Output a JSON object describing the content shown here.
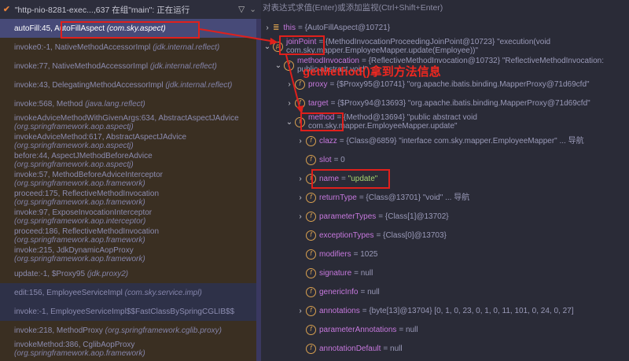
{
  "frames_header": {
    "thread": "\"http-nio-8281-exec...,637 在组\"main\": 正在运行",
    "filter_icon": "filter-icon",
    "dropdown_icon": "chevron-down-icon"
  },
  "frames": [
    {
      "method": "autoFill:45, AutoFillAspect",
      "pkg": "(com.sky.aspect)"
    },
    {
      "method": "invoke0:-1, NativeMethodAccessorImpl",
      "pkg": "(jdk.internal.reflect)"
    },
    {
      "method": "invoke:77, NativeMethodAccessorImpl",
      "pkg": "(jdk.internal.reflect)"
    },
    {
      "method": "invoke:43, DelegatingMethodAccessorImpl",
      "pkg": "(jdk.internal.reflect)"
    },
    {
      "method": "invoke:568, Method",
      "pkg": "(java.lang.reflect)"
    },
    {
      "method": "invokeAdviceMethodWithGivenArgs:634, AbstractAspectJAdvice",
      "pkg": "(org.springframework.aop.aspectj)"
    },
    {
      "method": "invokeAdviceMethod:617, AbstractAspectJAdvice",
      "pkg": "(org.springframework.aop.aspectj)"
    },
    {
      "method": "before:44, AspectJMethodBeforeAdvice",
      "pkg": "(org.springframework.aop.aspectj)"
    },
    {
      "method": "invoke:57, MethodBeforeAdviceInterceptor",
      "pkg": "(org.springframework.aop.framework)"
    },
    {
      "method": "proceed:175, ReflectiveMethodInvocation",
      "pkg": "(org.springframework.aop.framework)"
    },
    {
      "method": "invoke:97, ExposeInvocationInterceptor",
      "pkg": "(org.springframework.aop.interceptor)"
    },
    {
      "method": "proceed:186, ReflectiveMethodInvocation",
      "pkg": "(org.springframework.aop.framework)"
    },
    {
      "method": "invoke:215, JdkDynamicAopProxy",
      "pkg": "(org.springframework.aop.framework)"
    },
    {
      "method": "update:-1, $Proxy95",
      "pkg": "(jdk.proxy2)"
    },
    {
      "method": "edit:156, EmployeeServiceImpl",
      "pkg": "(com.sky.service.impl)"
    },
    {
      "method": "invoke:-1, EmployeeServiceImpl$$FastClassBySpringCGLIB$$",
      "pkg": ""
    },
    {
      "method": "invoke:218, MethodProxy",
      "pkg": "(org.springframework.cglib.proxy)"
    },
    {
      "method": "invokeMethod:386, CglibAopProxy",
      "pkg": "(org.springframework.aop.framework)"
    }
  ],
  "eval_placeholder": "对表达式求值(Enter)或添加监视(Ctrl+Shift+Enter)",
  "variables": [
    {
      "name": "this",
      "value": "= {AutoFillAspect@10721}"
    },
    {
      "name": "joinPoint",
      "value": "= {MethodInvocationProceedingJoinPoint@10723} \"execution(void com.sky.mapper.EmployeeMapper.update(Employee))\""
    },
    {
      "name": "methodInvocation",
      "value": "= {ReflectiveMethodInvocation@10732} \"ReflectiveMethodInvocation: public abstract void\""
    },
    {
      "name": "proxy",
      "value": "= {$Proxy95@10741} \"org.apache.ibatis.binding.MapperProxy@71d69cfd\""
    },
    {
      "name": "target",
      "value": "= {$Proxy94@13693} \"org.apache.ibatis.binding.MapperProxy@71d69cfd\""
    },
    {
      "name": "method",
      "value": "= {Method@13694} \"public abstract void com.sky.mapper.EmployeeMapper.update\""
    },
    {
      "name": "clazz",
      "value": "= {Class@6859} \"interface com.sky.mapper.EmployeeMapper\" ... 导航"
    },
    {
      "name": "slot",
      "value": "= 0"
    },
    {
      "name": "name",
      "value": "= ",
      "str": "\"update\""
    },
    {
      "name": "returnType",
      "value": "= {Class@13701} \"void\" ... 导航"
    },
    {
      "name": "parameterTypes",
      "value": "= {Class[1]@13702}"
    },
    {
      "name": "exceptionTypes",
      "value": "= {Class[0]@13703}"
    },
    {
      "name": "modifiers",
      "value": "= 1025"
    },
    {
      "name": "signature",
      "value": "= null"
    },
    {
      "name": "genericInfo",
      "value": "= null"
    },
    {
      "name": "annotations",
      "value": "= {byte[13]@13704} [0, 1, 0, 23, 0, 1, 0, 11, 101, 0, 24, 0, 27]"
    },
    {
      "name": "parameterAnnotations",
      "value": "= null"
    },
    {
      "name": "annotationDefault",
      "value": "= null"
    }
  ],
  "annotation": "getMethod()拿到方法信息",
  "colors": {
    "annotation_red": "#e0201c",
    "selected_frame": "#474a78",
    "field_name": "#c678dd"
  }
}
